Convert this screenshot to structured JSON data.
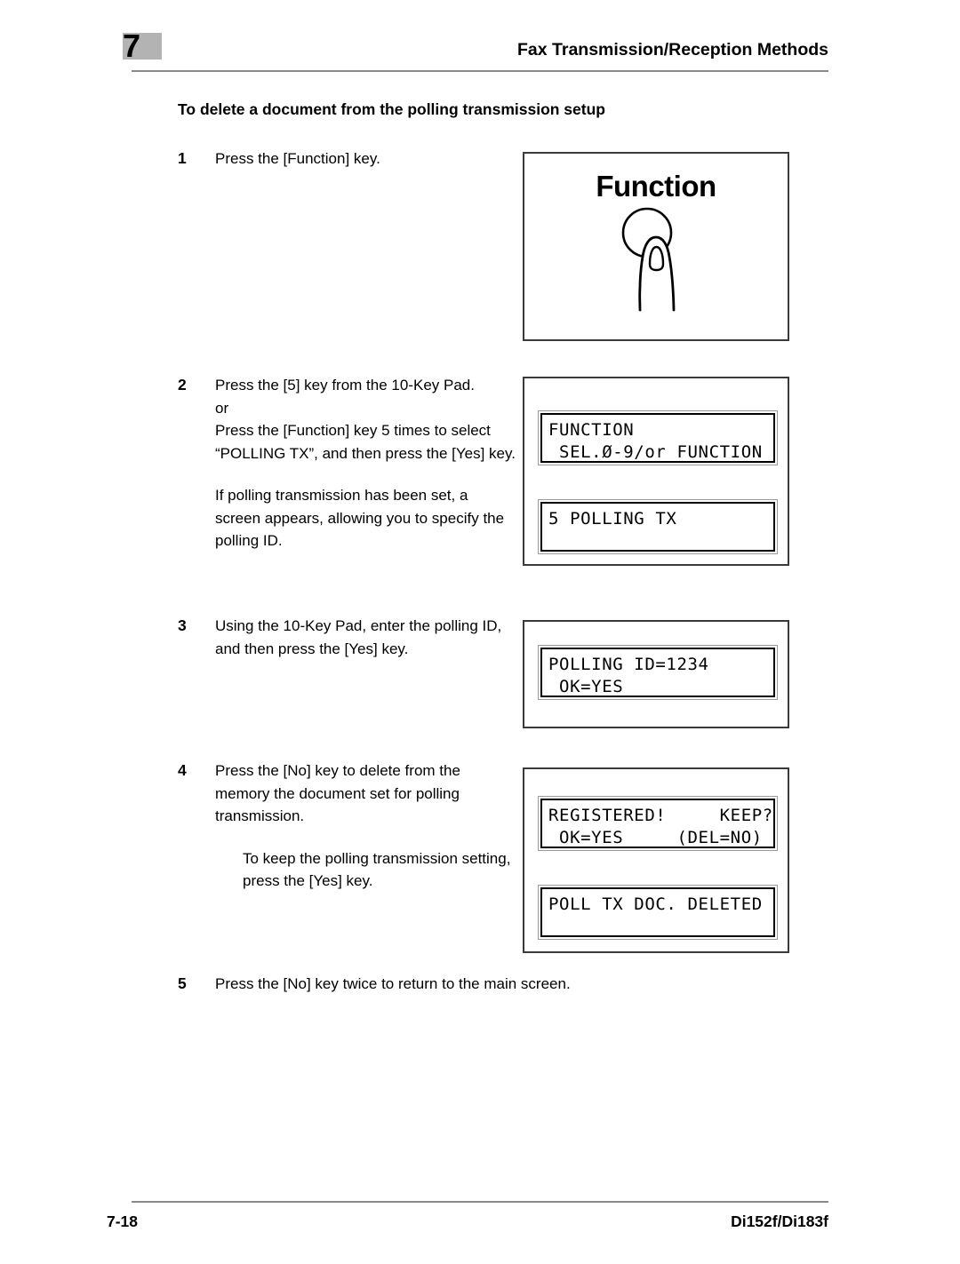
{
  "header": {
    "chapter_number": "7",
    "title": "Fax Transmission/Reception Methods"
  },
  "section": {
    "heading": "To delete a document from the polling transmission setup"
  },
  "steps": [
    {
      "number": "1",
      "lines": [
        "Press the [Function] key."
      ]
    },
    {
      "number": "2",
      "lines": [
        "Press the [5] key from the 10-Key Pad.",
        "or",
        "Press the [Function] key 5 times to select “POLLING TX”, and then press the [Yes] key."
      ],
      "note": "If polling transmission has been set, a screen appears, allowing you to specify the polling ID."
    },
    {
      "number": "3",
      "lines": [
        "Using the 10-Key Pad, enter the polling ID, and then press the [Yes] key."
      ]
    },
    {
      "number": "4",
      "lines": [
        "Press the [No] key to delete from the memory the document set for polling transmission."
      ],
      "note": "To keep the polling transmission setting, press the [Yes] key."
    },
    {
      "number": "5",
      "lines": [
        "Press the [No] key twice to return to the main screen."
      ]
    }
  ],
  "illustrations": {
    "function_key": {
      "label": "Function",
      "icon": "finger-pressing-button"
    },
    "step2": {
      "lcd_a": "FUNCTION\n SEL.Ø-9/or FUNCTION",
      "lcd_b": "5 POLLING TX"
    },
    "step3": {
      "lcd_a": "POLLING ID=1234\n OK=YES"
    },
    "step4": {
      "lcd_a": "REGISTERED!     KEEP?\n OK=YES     (DEL=NO)",
      "lcd_b": "POLL TX DOC. DELETED"
    }
  },
  "footer": {
    "page_number": "7-18",
    "model": "Di152f/Di183f"
  },
  "colors": {
    "text": "#000000",
    "rule": "#8a8a8a",
    "chapter_badge": "#b3b3b3",
    "panel_border": "#3a3a3a"
  }
}
